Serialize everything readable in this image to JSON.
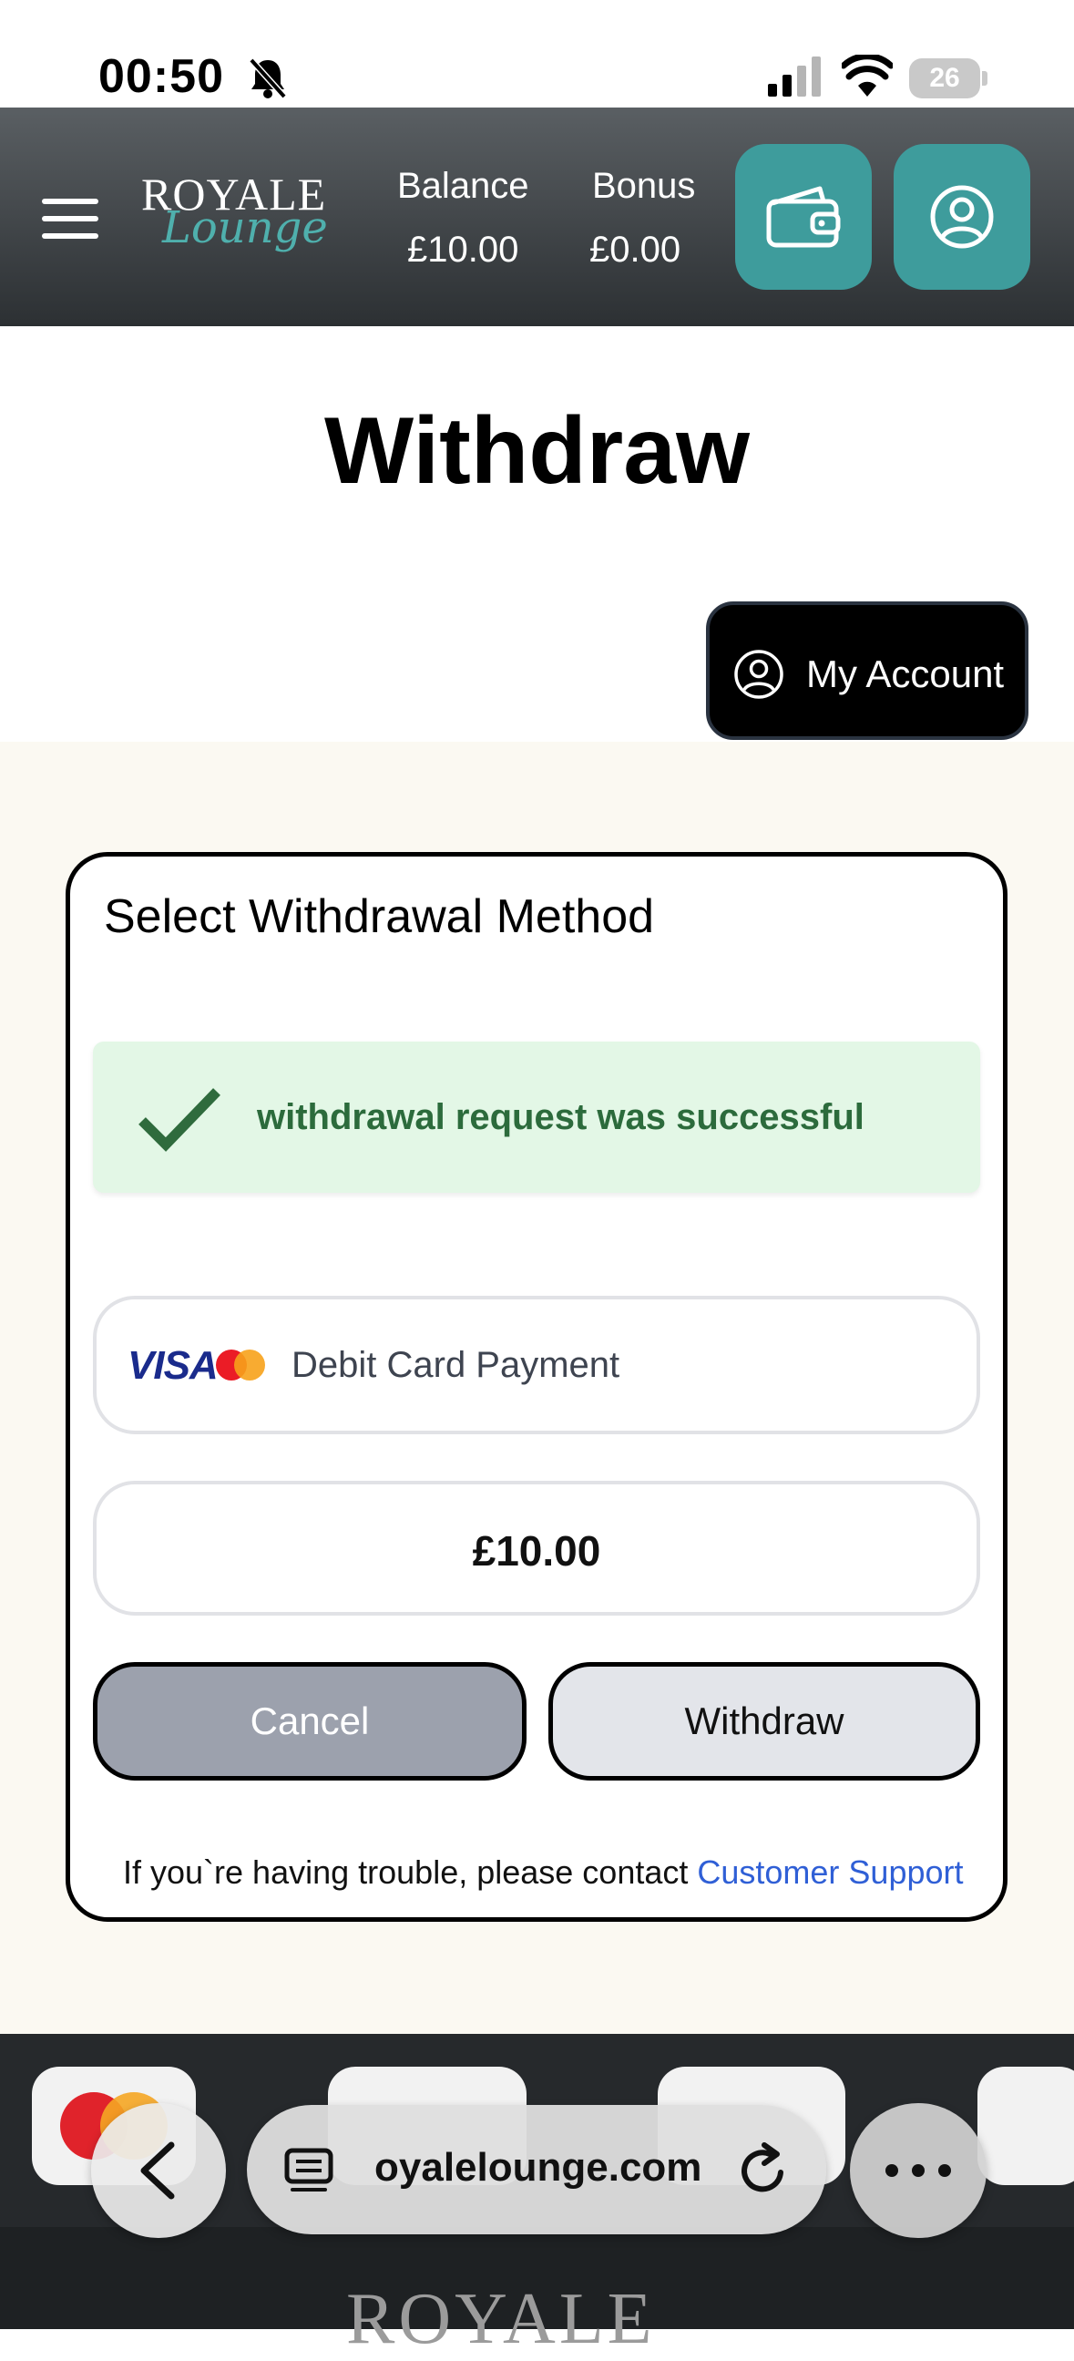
{
  "status_bar": {
    "time": "00:50",
    "battery": "26"
  },
  "header": {
    "logo_top": "ROYALE",
    "logo_bottom": "Lounge",
    "balance_label": "Balance",
    "balance_value": "£10.00",
    "bonus_label": "Bonus",
    "bonus_value": "£0.00"
  },
  "page": {
    "title": "Withdraw",
    "my_account_label": "My Account"
  },
  "withdraw_card": {
    "title": "Select Withdrawal Method",
    "success_message": "withdrawal request was successful",
    "method_brand": "VISA",
    "method_label": "Debit Card Payment",
    "amount": "£10.00",
    "cancel_label": "Cancel",
    "withdraw_label": "Withdraw",
    "trouble_text": "If you`re having trouble, please contact ",
    "support_link": "Customer Support"
  },
  "browser": {
    "url": "oyalelounge.com"
  },
  "footer": {
    "logo_text": "ROYALE"
  },
  "colors": {
    "header_bg": "#3a3f43",
    "accent_teal": "#3e9c9c",
    "success_bg": "#e3f7e6",
    "success_text": "#2c6b3c",
    "link_blue": "#2f5fd6",
    "content_bg": "#fbf9f2"
  },
  "icons": [
    "bell-slash-icon",
    "signal-icon",
    "wifi-icon",
    "menu-icon",
    "wallet-icon",
    "user-circle-icon",
    "check-icon",
    "mastercard-icon",
    "back-icon",
    "tabs-icon",
    "reload-icon",
    "more-icon"
  ]
}
